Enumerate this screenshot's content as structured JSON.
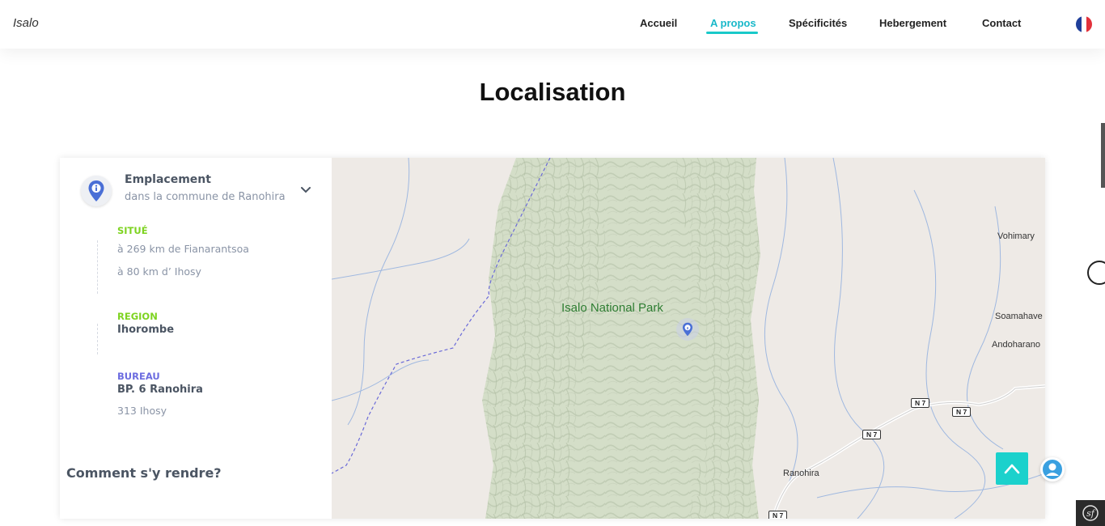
{
  "header": {
    "brand": "Isalo",
    "nav": [
      {
        "label": "Accueil",
        "active": false
      },
      {
        "label": "A propos",
        "active": true
      },
      {
        "label": "Spécificités",
        "active": false
      },
      {
        "label": "Hebergement",
        "active": false
      },
      {
        "label": "Contact",
        "active": false
      }
    ],
    "language_icon": "france-flag-icon",
    "accent_color": "#19c9c9"
  },
  "page": {
    "title": "Localisation"
  },
  "info_panel": {
    "emplacement_title": "Emplacement",
    "emplacement_subtitle": "dans la commune de Ranohira",
    "situe": {
      "label": "SITUÉ",
      "color": "#7ed321",
      "lines": [
        "à 269 km de Fianarantsoa",
        "à 80 km d’ Ihosy"
      ]
    },
    "region": {
      "label": "REGION",
      "color": "#7ed321",
      "value": "Ihorombe"
    },
    "bureau": {
      "label": "BUREAU",
      "color": "#6c6ce0",
      "value": "BP. 6 Ranohira",
      "extra": "313 Ihosy"
    },
    "how_to_get_there": "Comment s'y rendre?"
  },
  "map": {
    "park_label": "Isalo National Park",
    "places": [
      "Vohimary",
      "Soamahave",
      "Andoharano",
      "Ranohira"
    ],
    "road_labels": [
      "N 7",
      "N 7",
      "N 7",
      "N 7"
    ]
  },
  "floating": {
    "scroll_top_icon": "chevron-up-icon",
    "chat_icon": "user-chat-icon",
    "framework_badge_icon": "symfony-icon"
  }
}
